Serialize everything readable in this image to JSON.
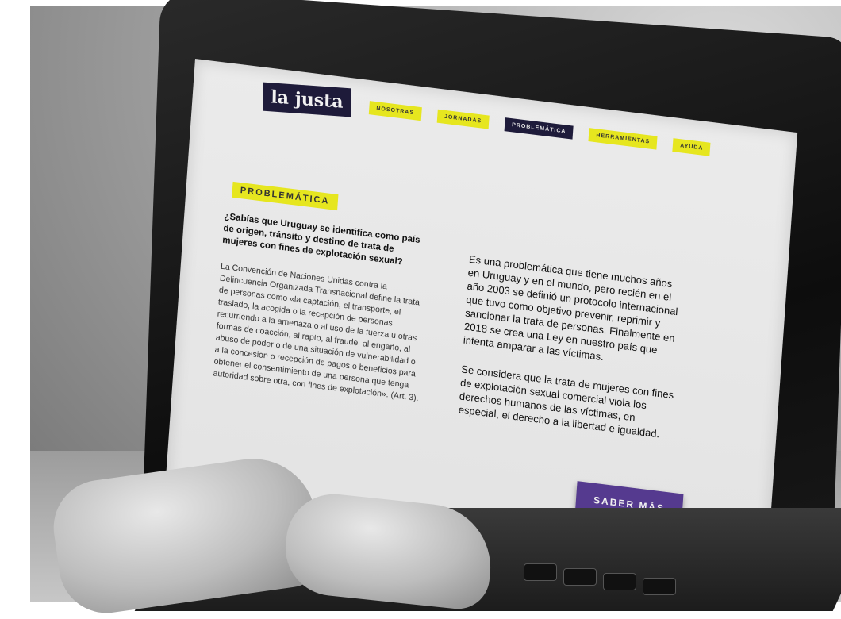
{
  "site": {
    "logo": "la justa",
    "nav": [
      {
        "label": "NOSOTRAS",
        "active": false
      },
      {
        "label": "JORNADAS",
        "active": false
      },
      {
        "label": "PROBLEMÁTICA",
        "active": true
      },
      {
        "label": "HERRAMIENTAS",
        "active": false
      },
      {
        "label": "AYUDA",
        "active": false
      }
    ]
  },
  "section": {
    "label": "PROBLEMÁTICA"
  },
  "left_column": {
    "lead": "¿Sabías que Uruguay se identifica como país de origen, tránsito y destino de trata de mujeres con fines de explotación sexual?",
    "quote": "La Convención de Naciones Unidas contra la Delincuencia Organizada Transnacional define la trata de personas como «la captación, el transporte, el traslado, la acogida o la recepción de personas recurriendo a la amenaza o al uso de la fuerza u otras formas de coacción, al rapto, al fraude, al engaño, al abuso de poder o de una situación de vulnerabilidad o a la concesión o recepción de pagos o beneficios para obtener el consentimiento de una persona que tenga autoridad sobre otra, con fines de explotación». (Art. 3)."
  },
  "right_column": {
    "paragraph_1": "Es una problemática que tiene muchos años en Uruguay y en el mundo, pero recién en el año 2003 se definió un protocolo internacional que tuvo como objetivo prevenir, reprimir y sancionar la trata de personas. Finalmente en 2018 se crea una Ley en nuestro país que intenta amparar a las víctimas.",
    "paragraph_2": "Se considera que la trata de mujeres con fines de explotación sexual comercial viola los derechos humanos de las víctimas, en especial, el derecho a la libertad e igualdad."
  },
  "cta": {
    "label": "SABER MÁS"
  },
  "colors": {
    "accent_yellow": "#e6e61f",
    "navy": "#1e1b3a",
    "purple": "#553a8f"
  }
}
